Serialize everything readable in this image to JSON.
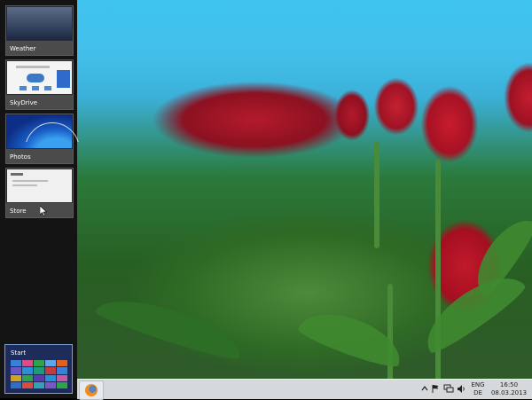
{
  "switcher": {
    "apps": [
      {
        "label": "Weather"
      },
      {
        "label": "SkyDrive"
      },
      {
        "label": "Photos"
      },
      {
        "label": "Store"
      }
    ],
    "start_label": "Start"
  },
  "taskbar": {
    "pinned": [
      {
        "name": "firefox-icon"
      }
    ],
    "tray_icons": [
      "chevron-up-icon",
      "flag-icon",
      "network-icon",
      "volume-icon"
    ],
    "lang_line1": "ENG",
    "lang_line2": "DE",
    "time": "16:50",
    "date": "08.03.2013"
  },
  "colors": {
    "switcher_bg": "#141414",
    "start_tile_bg": "#1d2c5a",
    "taskbar_bg": "#d5d9dc",
    "sky": "#3fc3ef",
    "tulip_red": "#b31b2c"
  }
}
